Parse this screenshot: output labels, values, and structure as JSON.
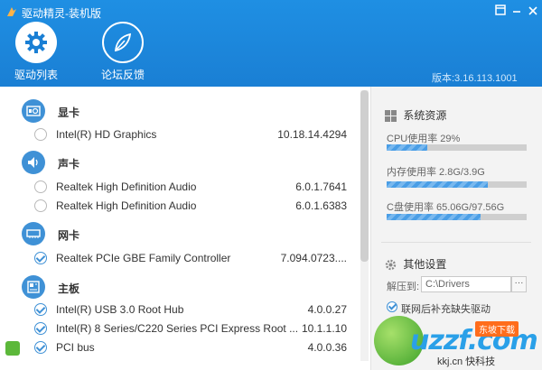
{
  "app": {
    "title": "驱动精灵-装机版",
    "version": "版本:3.16.113.1001"
  },
  "tabs": [
    {
      "label": "驱动列表",
      "icon": "gear-icon",
      "active": true
    },
    {
      "label": "论坛反馈",
      "icon": "leaf-icon",
      "active": false
    }
  ],
  "drivers": {
    "categories": [
      {
        "name": "显卡",
        "icon": "graphics-card-icon",
        "items": [
          {
            "name": "Intel(R) HD Graphics",
            "version": "10.18.14.4294",
            "checked": false
          }
        ]
      },
      {
        "name": "声卡",
        "icon": "speaker-icon",
        "items": [
          {
            "name": "Realtek High Definition Audio",
            "version": "6.0.1.7641",
            "checked": false
          },
          {
            "name": "Realtek High Definition Audio",
            "version": "6.0.1.6383",
            "checked": false
          }
        ]
      },
      {
        "name": "网卡",
        "icon": "network-card-icon",
        "items": [
          {
            "name": "Realtek PCIe GBE Family Controller",
            "version": "7.094.0723....",
            "checked": true
          }
        ]
      },
      {
        "name": "主板",
        "icon": "motherboard-icon",
        "items": [
          {
            "name": "Intel(R) USB 3.0 Root Hub",
            "version": "4.0.0.27",
            "checked": true
          },
          {
            "name": "Intel(R) 8 Series/C220 Series PCI Express Root ...",
            "version": "10.1.1.10",
            "checked": true
          },
          {
            "name": "PCI bus",
            "version": "4.0.0.36",
            "checked": true
          }
        ]
      }
    ]
  },
  "system": {
    "title": "系统资源",
    "cpu": {
      "label": "CPU使用率 29%",
      "value": 0.29
    },
    "mem": {
      "label": "内存使用率 2.8G/3.9G",
      "value": 0.72
    },
    "disk": {
      "label": "C盘使用率 65.06G/97.56G",
      "value": 0.67
    }
  },
  "settings": {
    "title": "其他设置",
    "path_label": "解压到:",
    "path_value": "C:\\Drivers",
    "browse_label": "···",
    "auto_label": "联网后补充缺失驱动"
  },
  "watermark": {
    "text": "uzzf.com",
    "badge": "东坡下载",
    "sub": "kkj.cn 快科技"
  },
  "colors": {
    "header": "#1a7fd4",
    "accent": "#3f91d6"
  }
}
